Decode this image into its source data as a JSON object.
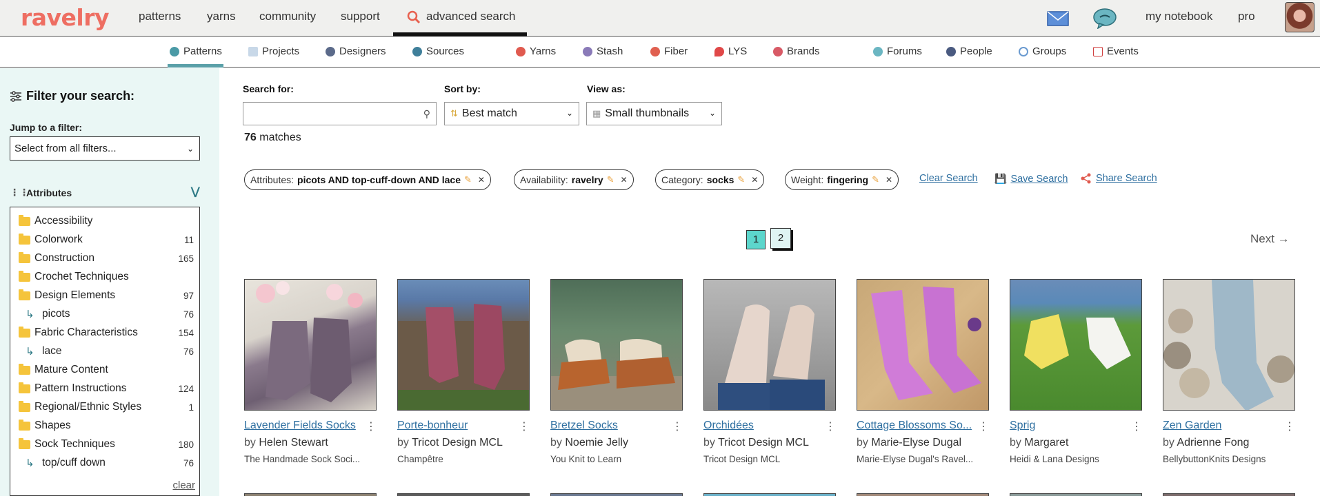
{
  "topnav": {
    "logo": "ravelry",
    "links": [
      "patterns",
      "yarns",
      "community",
      "support",
      "advanced search"
    ],
    "right_links": [
      "my notebook",
      "pro"
    ]
  },
  "subnav": {
    "tabs": [
      "Patterns",
      "Projects",
      "Designers",
      "Sources",
      "Yarns",
      "Stash",
      "Fiber",
      "LYS",
      "Brands",
      "Forums",
      "People",
      "Groups",
      "Events"
    ]
  },
  "sidebar": {
    "title": "Filter your search:",
    "jump_label": "Jump to a filter:",
    "jump_value": "Select from all filters...",
    "attributes_label": "Attributes",
    "items": [
      {
        "label": "Accessibility",
        "count": ""
      },
      {
        "label": "Colorwork",
        "count": "11"
      },
      {
        "label": "Construction",
        "count": "165"
      },
      {
        "label": "Crochet Techniques",
        "count": ""
      },
      {
        "label": "Design Elements",
        "count": "97"
      },
      {
        "label": "picots",
        "count": "76"
      },
      {
        "label": "Fabric Characteristics",
        "count": "154"
      },
      {
        "label": "lace",
        "count": "76"
      },
      {
        "label": "Mature Content",
        "count": ""
      },
      {
        "label": "Pattern Instructions",
        "count": "124"
      },
      {
        "label": "Regional/Ethnic Styles",
        "count": "1"
      },
      {
        "label": "Shapes",
        "count": ""
      },
      {
        "label": "Sock Techniques",
        "count": "180"
      },
      {
        "label": "top/cuff down",
        "count": "76"
      }
    ],
    "clear": "clear"
  },
  "search": {
    "search_label": "Search for:",
    "search_value": "",
    "sort_label": "Sort by:",
    "sort_value": "Best match",
    "view_label": "View as:",
    "view_value": "Small thumbnails",
    "match_count": "76",
    "match_text": "matches"
  },
  "chips": [
    {
      "key": "Attributes:",
      "value": "picots AND top-cuff-down AND lace"
    },
    {
      "key": "Availability:",
      "value": "ravelry"
    },
    {
      "key": "Category:",
      "value": "socks"
    },
    {
      "key": "Weight:",
      "value": "fingering"
    }
  ],
  "actions": {
    "clear": "Clear Search",
    "save": "Save Search",
    "share": "Share Search"
  },
  "pager": {
    "page1": "1",
    "page2": "2",
    "next": "Next →"
  },
  "results": [
    {
      "title": "Lavender Fields Socks",
      "by": "by",
      "author": "Helen Stewart",
      "source": "The Handmade Sock Soci..."
    },
    {
      "title": "Porte-bonheur",
      "by": "by",
      "author": "Tricot Design MCL",
      "source": "Champêtre"
    },
    {
      "title": "Bretzel Socks",
      "by": "by",
      "author": "Noemie Jelly",
      "source": "You Knit to Learn"
    },
    {
      "title": "Orchidées",
      "by": "by",
      "author": "Tricot Design MCL",
      "source": "Tricot Design MCL"
    },
    {
      "title": "Cottage Blossoms So...",
      "by": "by",
      "author": "Marie-Elyse Dugal",
      "source": "Marie-Elyse Dugal's Ravel..."
    },
    {
      "title": "Sprig",
      "by": "by",
      "author": "Margaret",
      "source": "Heidi & Lana Designs"
    },
    {
      "title": "Zen Garden",
      "by": "by",
      "author": "Adrienne Fong",
      "source": "BellybuttonKnits Designs"
    }
  ]
}
